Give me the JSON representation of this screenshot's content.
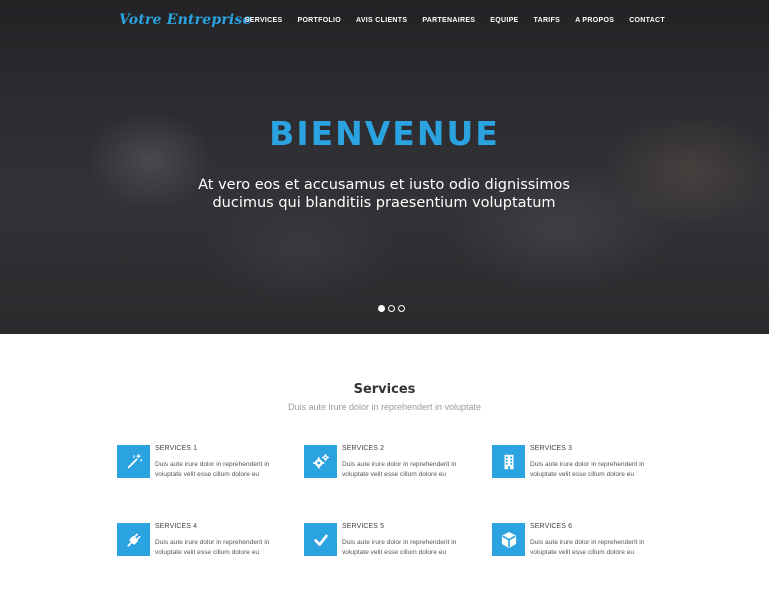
{
  "header": {
    "brand": "Votre Entreprise",
    "nav": [
      "SERVICES",
      "PORTFOLIO",
      "AVIS CLIENTS",
      "PARTENAIRES",
      "EQUIPE",
      "TARIFS",
      "A PROPOS",
      "CONTACT"
    ]
  },
  "hero": {
    "title": "BIENVENUE",
    "subtitle_line1": "At vero eos et accusamus et iusto odio dignissimos",
    "subtitle_line2": "ducimus qui blanditiis praesentium voluptatum",
    "slides": 3,
    "active_slide": 1
  },
  "services_section": {
    "title": "Services",
    "subtitle": "Duis aute irure dolor in reprehendert in voluptate"
  },
  "services": [
    {
      "title": "SERVICES 1",
      "line1": "Duis aute irure dolor in reprehenderit in",
      "line2": "voluptate velit esse cillum dolore eu",
      "icon": "magic-wand-icon"
    },
    {
      "title": "SERVICES 2",
      "line1": "Duis aute irure dolor in reprehenderit in",
      "line2": "voluptate velit esse cillum dolore eu",
      "icon": "gears-icon"
    },
    {
      "title": "SERVICES 3",
      "line1": "Duis aute irure dolor in reprehenderit in",
      "line2": "voluptate velit esse cillum dolore eu",
      "icon": "building-icon"
    },
    {
      "title": "SERVICES 4",
      "line1": "Duis aute irure dolor in reprehenderit in",
      "line2": "voluptate velit esse cillum dolore eu",
      "icon": "plug-icon"
    },
    {
      "title": "SERVICES 5",
      "line1": "Duis aute irure dolor in reprehenderit in",
      "line2": "voluptate velit esse cillum dolore eu",
      "icon": "checkmark-icon"
    },
    {
      "title": "SERVICES 6",
      "line1": "Duis aute irure dolor in reprehenderit in",
      "line2": "voluptate velit esse cillum dolore eu",
      "icon": "cube-icon"
    }
  ],
  "colors": {
    "accent": "#2aa3e0",
    "hero_bg": "#2c2c30",
    "text_dark": "#333333",
    "text_muted": "#9a9a9a"
  }
}
